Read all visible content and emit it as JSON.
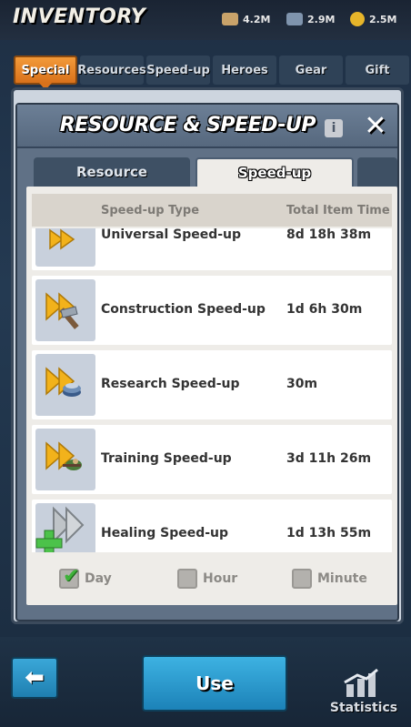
{
  "header": {
    "title": "INVENTORY",
    "resources": [
      {
        "icon": "wood-icon",
        "value": "4.2M"
      },
      {
        "icon": "iron-icon",
        "value": "2.9M"
      },
      {
        "icon": "gold-coin-icon",
        "value": "2.5M"
      }
    ]
  },
  "categories": [
    "Special",
    "Resources",
    "Speed-up",
    "Heroes",
    "Gear",
    "Gift"
  ],
  "dialog": {
    "title": "RESOURCE & SPEED-UP",
    "info": "i",
    "close": "✕",
    "tabs": [
      "Resource",
      "Speed-up"
    ],
    "columns": {
      "type": "Speed-up Type",
      "time": "Total Item Time"
    },
    "rows": [
      {
        "name": "Universal Speed-up",
        "time": "8d 18h 38m",
        "icon": "universal-speedup-icon"
      },
      {
        "name": "Construction Speed-up",
        "time": "1d 6h 30m",
        "icon": "construction-speedup-icon"
      },
      {
        "name": "Research Speed-up",
        "time": "30m",
        "icon": "research-speedup-icon"
      },
      {
        "name": "Training Speed-up",
        "time": "3d 11h 26m",
        "icon": "training-speedup-icon"
      },
      {
        "name": "Healing Speed-up",
        "time": "1d 13h 55m",
        "icon": "healing-speedup-icon"
      }
    ],
    "filters": [
      {
        "label": "Day",
        "checked": true
      },
      {
        "label": "Hour",
        "checked": false
      },
      {
        "label": "Minute",
        "checked": false
      }
    ]
  },
  "footer": {
    "use": "Use",
    "statistics": "Statistics"
  },
  "colors": {
    "accent_orange": "#e8822a",
    "button_blue": "#2a97cc",
    "check_green": "#3fb23a"
  }
}
